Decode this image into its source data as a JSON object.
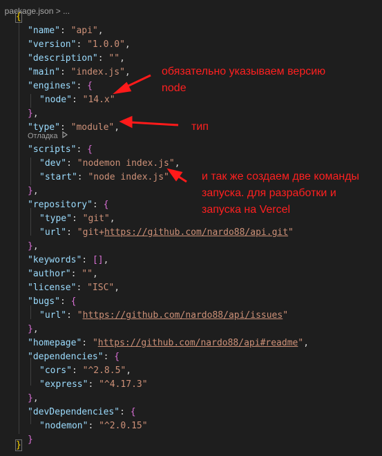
{
  "breadcrumb": {
    "file": "package.json",
    "sep": ">",
    "more": "..."
  },
  "code": {
    "open": "{",
    "close": "}",
    "name_key": "\"name\"",
    "name_val": "\"api\"",
    "version_key": "\"version\"",
    "version_val": "\"1.0.0\"",
    "description_key": "\"description\"",
    "description_val": "\"\"",
    "main_key": "\"main\"",
    "main_val": "\"index.js\"",
    "engines_key": "\"engines\"",
    "node_key": "\"node\"",
    "node_val": "\"14.x\"",
    "type_key": "\"type\"",
    "type_val": "\"module\"",
    "scripts_key": "\"scripts\"",
    "dev_key": "\"dev\"",
    "dev_val": "\"nodemon index.js\"",
    "start_key": "\"start\"",
    "start_val": "\"node index.js\"",
    "repository_key": "\"repository\"",
    "repo_type_key": "\"type\"",
    "repo_type_val": "\"git\"",
    "repo_url_key": "\"url\"",
    "repo_url_prefix": "\"git+",
    "repo_url_link": "https://github.com/nardo88/api.git",
    "repo_url_suffix": "\"",
    "keywords_key": "\"keywords\"",
    "keywords_val": "[]",
    "author_key": "\"author\"",
    "author_val": "\"\"",
    "license_key": "\"license\"",
    "license_val": "\"ISC\"",
    "bugs_key": "\"bugs\"",
    "bugs_url_key": "\"url\"",
    "bugs_url_link": "https://github.com/nardo88/api/issues",
    "homepage_key": "\"homepage\"",
    "homepage_link": "https://github.com/nardo88/api#readme",
    "dependencies_key": "\"dependencies\"",
    "cors_key": "\"cors\"",
    "cors_val": "\"^2.8.5\"",
    "express_key": "\"express\"",
    "express_val": "\"^4.17.3\"",
    "devdeps_key": "\"devDependencies\"",
    "nodemon_key": "\"nodemon\"",
    "nodemon_val": "\"^2.0.15\""
  },
  "codelens": {
    "label": "Отладка",
    "icon": "play-icon"
  },
  "annotations": {
    "engines_note_1": "обязательно указываем версию",
    "engines_note_2": "node",
    "type_note": "тип",
    "scripts_note_1": "и так же создаем две команды",
    "scripts_note_2": "запуска. для разработки и",
    "scripts_note_3": "запуска на Vercel"
  },
  "colors": {
    "background": "#1e1e1e",
    "key": "#9cdcfe",
    "string": "#ce9178",
    "bracket_level1": "#ffd700",
    "bracket_level2": "#da70d6",
    "annotation": "#ff2020"
  }
}
